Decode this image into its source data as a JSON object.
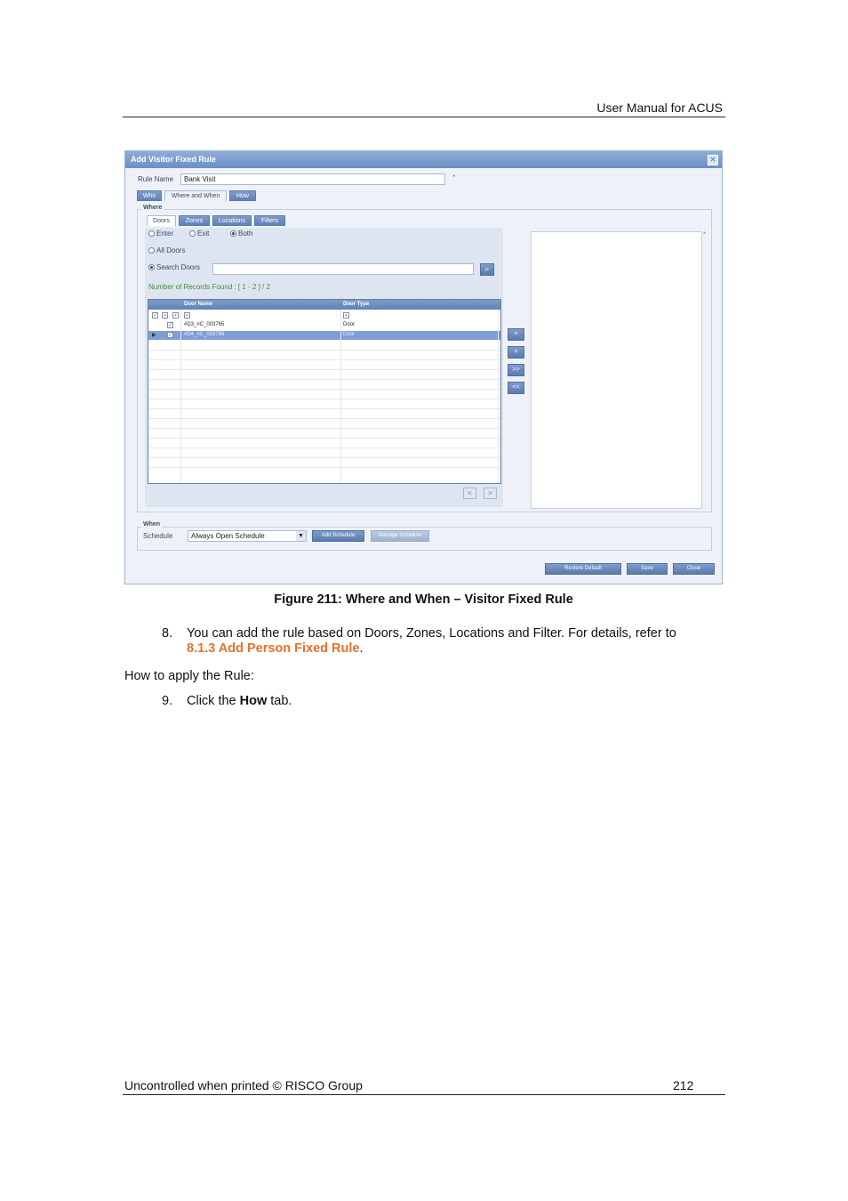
{
  "header": {
    "title": "User Manual for ACUS"
  },
  "dialog": {
    "title": "Add Visitor Fixed Rule",
    "rule_name_label": "Rule Name",
    "rule_name_value": "Bank Visit",
    "required_mark": "*",
    "tabs": [
      "Who",
      "Where and When",
      "How"
    ],
    "where_legend": "Where",
    "sub_tabs": [
      "Doors",
      "Zones",
      "Locations",
      "Filters"
    ],
    "direction_options": [
      "Enter",
      "Exit",
      "Both"
    ],
    "all_doors_label": "All Doors",
    "search_doors_label": "Search Doors",
    "records_found": "Number of Records Found : [ 1 - 2 ] / 2",
    "grid": {
      "columns": [
        "Door Name",
        "Door Type"
      ],
      "rows": [
        {
          "name": "#D3_#C_003765",
          "type": "Door"
        },
        {
          "name": "#D4_#C_003766",
          "type": "Door"
        }
      ]
    },
    "move_buttons": [
      ">",
      "<",
      ">>",
      "<<"
    ],
    "pager": [
      "<",
      ">"
    ],
    "when_legend": "When",
    "schedule_label": "Schedule",
    "schedule_value": "Always Open Schedule",
    "add_schedule": "Add Schedule",
    "manage_schedule": "Manage Schedule",
    "footer_buttons": [
      "Restore Default",
      "Save",
      "Close"
    ]
  },
  "caption": "Figure 211: Where and When – Visitor Fixed Rule",
  "steps": {
    "step8_num": "8.",
    "step8_text": "You can add the rule based on Doors, Zones, Locations and Filter. For details, refer to",
    "step8_link": "8.1.3 Add Person Fixed Rule",
    "step8_end": ".",
    "how_to": "How to apply the Rule:",
    "step9_num": "9.",
    "step9_pre": "Click the ",
    "step9_bold": "How",
    "step9_post": " tab."
  },
  "footer": {
    "left": "Uncontrolled when printed © RISCO Group",
    "page": "212"
  }
}
